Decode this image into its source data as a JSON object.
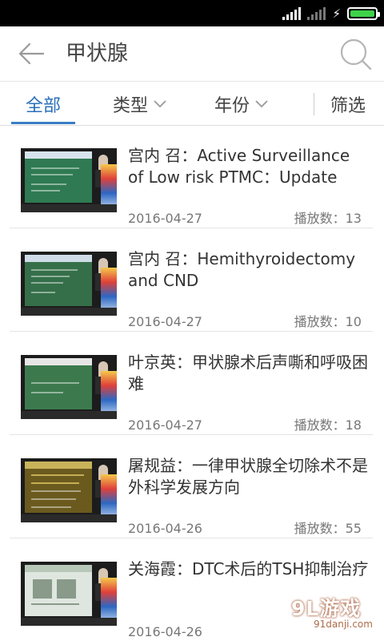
{
  "header": {
    "title": "甲状腺",
    "back_icon": "arrow-left-icon",
    "search_icon": "search-icon"
  },
  "tabs": {
    "all": "全部",
    "type": "类型",
    "year": "年份",
    "filter": "筛选",
    "active": "全部",
    "active_color": "#2a70b8"
  },
  "list": [
    {
      "title": "宫内 召：Active Surveillance of Low risk PTMC：Update",
      "date": "2016-04-27",
      "plays": "播放数：13"
    },
    {
      "title": "宫内 召：Hemithyroidectomy and CND",
      "date": "2016-04-27",
      "plays": "播放数：10"
    },
    {
      "title": "叶京英：甲状腺术后声嘶和呼吸困难",
      "date": "2016-04-27",
      "plays": "播放数：18"
    },
    {
      "title": "屠规益：一律甲状腺全切除术不是外科学发展方向",
      "date": "2016-04-26",
      "plays": "播放数：55"
    },
    {
      "title": "关海霞：DTC术后的TSH抑制治疗",
      "date": "2016-04-26",
      "plays": ""
    }
  ],
  "watermark": {
    "main": "9L游戏",
    "sub": "91danji.com"
  }
}
